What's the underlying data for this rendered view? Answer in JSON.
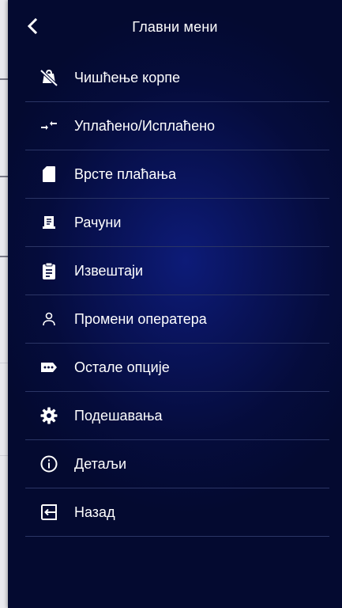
{
  "header": {
    "title": "Главни мени"
  },
  "menu": {
    "items": [
      {
        "label": "Чишћење корпе",
        "icon": "clear-cart-icon"
      },
      {
        "label": "Уплаћено/Исплаћено",
        "icon": "transfer-arrows-icon"
      },
      {
        "label": "Врсте плаћања",
        "icon": "document-icon"
      },
      {
        "label": "Рачуни",
        "icon": "receipt-icon"
      },
      {
        "label": "Извештаји",
        "icon": "clipboard-icon"
      },
      {
        "label": "Промени оператера",
        "icon": "person-icon"
      },
      {
        "label": "Остале опције",
        "icon": "more-label-icon"
      },
      {
        "label": "Подешавања",
        "icon": "gear-icon"
      },
      {
        "label": "Детаљи",
        "icon": "info-icon"
      },
      {
        "label": "Назад",
        "icon": "exit-icon"
      }
    ]
  },
  "colors": {
    "drawer_background": "#050c3c",
    "drawer_glow": "#0d1b78",
    "divider": "#2b3565",
    "text": "#ffffff"
  }
}
